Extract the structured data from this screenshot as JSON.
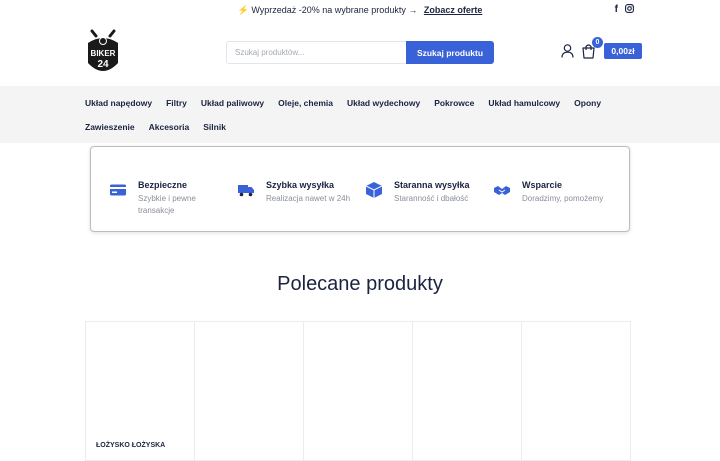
{
  "promo": {
    "message": "⚡ Wyprzedaż -20% na wybrane produkty →",
    "link": "Zobacz oferte",
    "social_icons": [
      "facebook-icon",
      "instagram-icon"
    ]
  },
  "header": {
    "logo_text": "BIKER 24",
    "search_placeholder": "Szukaj produktów...",
    "search_button": "Szukaj produktu",
    "cart_count": "0",
    "cart_total": "0,00zł"
  },
  "nav": {
    "items": [
      "Układ napędowy",
      "Filtry",
      "Układ paliwowy",
      "Oleje, chemia",
      "Układ wydechowy",
      "Pokrowce",
      "Układ hamulcowy",
      "Opony",
      "Zawieszenie",
      "Akcesoria",
      "Silnik"
    ]
  },
  "features": [
    {
      "icon": "credit-card-icon",
      "title": "Bezpieczne",
      "desc": "Szybkie i pewne transakcje"
    },
    {
      "icon": "truck-icon",
      "title": "Szybka wysyłka",
      "desc": "Realizacja nawet w 24h"
    },
    {
      "icon": "box-icon",
      "title": "Staranna wysyłka",
      "desc": "Staranność i dbałość"
    },
    {
      "icon": "handshake-icon",
      "title": "Wsparcie",
      "desc": "Doradzimy, pomożemy"
    }
  ],
  "section": {
    "title": "Polecane produkty"
  },
  "products": [
    {
      "name": "ŁOŻYSKO ŁOŻYSKA"
    },
    {
      "name": ""
    },
    {
      "name": ""
    },
    {
      "name": ""
    },
    {
      "name": ""
    }
  ],
  "colors": {
    "accent": "#3a62d8",
    "text": "#1a2340",
    "nav_bg": "#f4f4f5"
  }
}
